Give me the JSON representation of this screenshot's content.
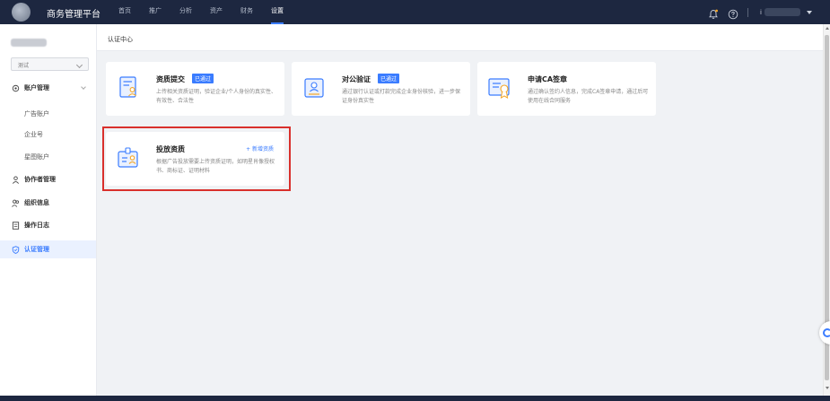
{
  "app": {
    "title": "商务管理平台"
  },
  "top_nav": {
    "items": [
      {
        "label": "首页",
        "active": false
      },
      {
        "label": "推广",
        "active": false
      },
      {
        "label": "分析",
        "active": false
      },
      {
        "label": "资产",
        "active": false
      },
      {
        "label": "财务",
        "active": false
      },
      {
        "label": "设置",
        "active": true
      }
    ]
  },
  "header": {
    "user_name": "i"
  },
  "sidebar": {
    "select_value": "测试",
    "groups": {
      "account": {
        "label": "账户管理",
        "children": [
          "广告账户",
          "企业号",
          "星图账户"
        ]
      },
      "collaborator": {
        "label": "协作者管理"
      },
      "org": {
        "label": "组织信息"
      },
      "log": {
        "label": "操作日志"
      },
      "cert": {
        "label": "认证管理"
      }
    }
  },
  "main": {
    "breadcrumb": "认证中心",
    "cards": [
      {
        "title": "资质提交",
        "badge": "已通过",
        "desc": "上传相关资质证明，验证企业/个人身份的真实性、有效性、合法性"
      },
      {
        "title": "对公验证",
        "badge": "已通过",
        "desc": "通过银行认证或打款完成企业身份核验，进一步保证身份真实性"
      },
      {
        "title": "申请CA签章",
        "desc": "通过确认签约人信息，完成CA签章申请，通过后可使用在线合同服务"
      },
      {
        "title": "投放资质",
        "action": "+ 新增资质",
        "desc": "根据广告投放需要上传资质证明，如明星肖像授权书、商标证、证明材料"
      }
    ]
  },
  "colors": {
    "accent": "#3a7cff",
    "topbar": "#1d2740",
    "highlight": "#d9302c"
  }
}
